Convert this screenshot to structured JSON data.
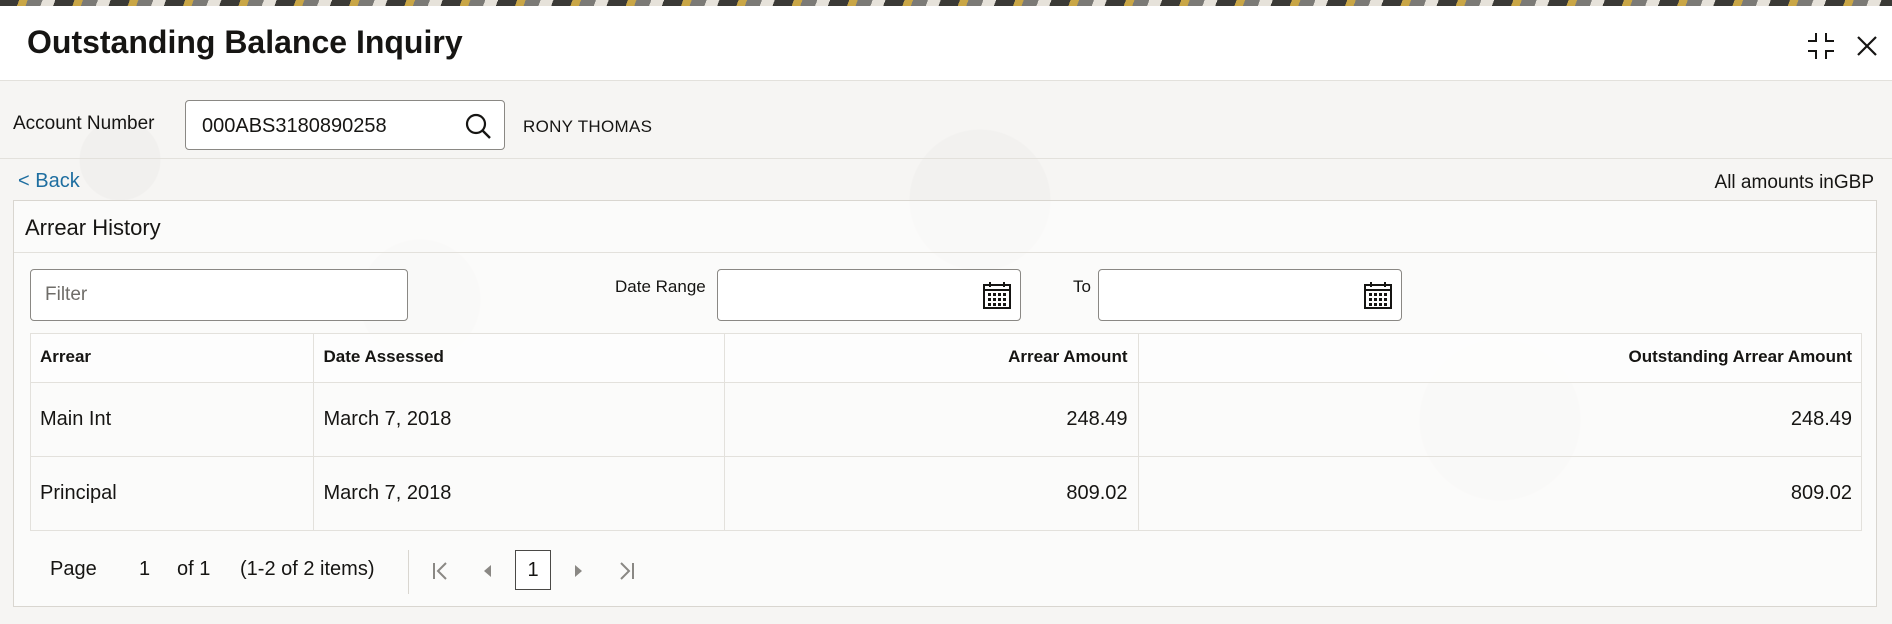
{
  "window": {
    "title": "Outstanding Balance Inquiry"
  },
  "account": {
    "label": "Account Number",
    "value": "000ABS3180890258",
    "holder_name": "RONY THOMAS"
  },
  "nav": {
    "back_label": "< Back",
    "amount_note": "All amounts inGBP"
  },
  "panel": {
    "title": "Arrear History",
    "filter_placeholder": "Filter",
    "date_range_label": "Date Range",
    "to_label": "To",
    "date_from_value": "",
    "date_to_value": ""
  },
  "table": {
    "columns": [
      "Arrear",
      "Date Assessed",
      "Arrear Amount",
      "Outstanding Arrear Amount"
    ],
    "rows": [
      {
        "arrear": "Main Int",
        "date_assessed": "March 7, 2018",
        "arrear_amount": "248.49",
        "outstanding_amount": "248.49"
      },
      {
        "arrear": "Principal",
        "date_assessed": "March 7, 2018",
        "arrear_amount": "809.02",
        "outstanding_amount": "809.02"
      }
    ]
  },
  "pagination": {
    "page_label": "Page",
    "current_page": "1",
    "of_label": "of 1",
    "items_summary": "(1-2 of 2 items)",
    "page_button": "1"
  },
  "icons": {
    "search": "search-icon",
    "calendar": "calendar-icon",
    "minimize": "minimize-icon",
    "close": "close-icon"
  },
  "colors": {
    "link": "#1e6ea0",
    "text": "#161513",
    "border": "#8a8884"
  }
}
